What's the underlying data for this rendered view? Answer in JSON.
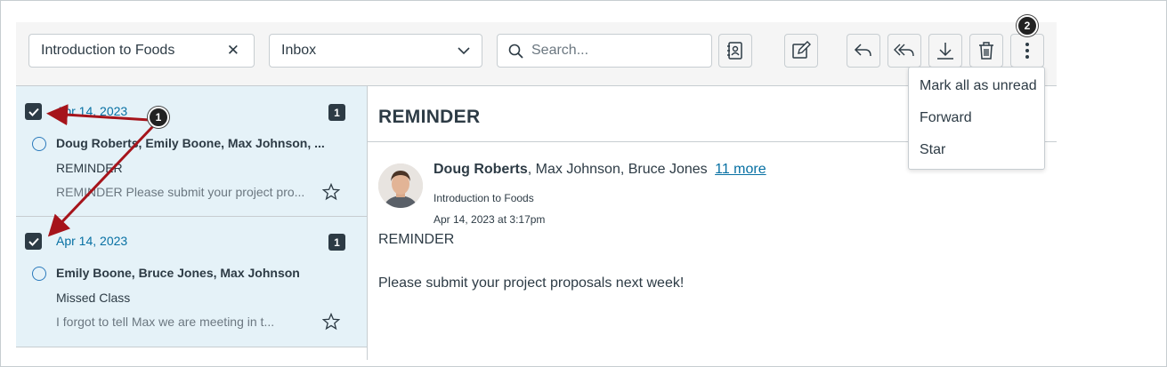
{
  "toolbar": {
    "course_filter": "Introduction to Foods",
    "mailbox_select": "Inbox",
    "search_placeholder": "Search..."
  },
  "conversations": [
    {
      "date": "Apr 14, 2023",
      "count": "1",
      "participants": "Doug Roberts, Emily Boone, Max Johnson, ...",
      "subject": "REMINDER",
      "preview": "REMINDER Please submit your project pro..."
    },
    {
      "date": "Apr 14, 2023",
      "count": "1",
      "participants": "Emily Boone, Bruce Jones, Max Johnson",
      "subject": "Missed Class",
      "preview": "I forgot to tell Max we are meeting in t..."
    }
  ],
  "message": {
    "title": "REMINDER",
    "sender": "Doug Roberts",
    "recipients": ", Max Johnson, Bruce Jones",
    "more": "11 more",
    "course": "Introduction to Foods",
    "timestamp": "Apr 14, 2023 at 3:17pm",
    "body_line1": "REMINDER",
    "body_line2": "Please submit your project proposals next week!"
  },
  "menu": {
    "items": [
      "Mark all as unread",
      "Forward",
      "Star"
    ]
  },
  "callouts": [
    "1",
    "2"
  ],
  "colors": {
    "selected_bg": "#e5f2f8",
    "link": "#0770a3",
    "text": "#2d3b45",
    "arrow": "#a6141b"
  }
}
